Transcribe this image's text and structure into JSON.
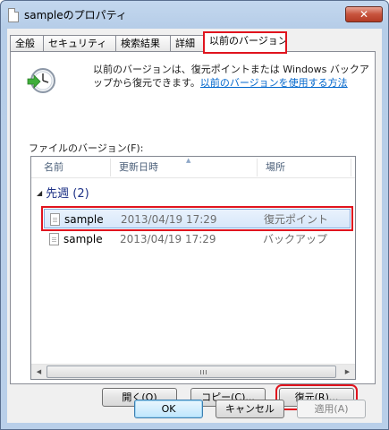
{
  "window": {
    "title": "sampleのプロパティ",
    "close_label": "✕"
  },
  "tabs": [
    {
      "label": "全般"
    },
    {
      "label": "セキュリティ"
    },
    {
      "label": "検索結果"
    },
    {
      "label": "詳細"
    },
    {
      "label": "以前のバージョン"
    }
  ],
  "panel": {
    "description": "以前のバージョンは、復元ポイントまたは Windows バックアップから復元できます。",
    "link_text": "以前のバージョンを使用する方法",
    "files_label": "ファイルのバージョン(F):"
  },
  "listview": {
    "columns": [
      "名前",
      "更新日時",
      "場所"
    ],
    "group": {
      "label": "先週 (2)"
    },
    "rows": [
      {
        "name": "sample",
        "date": "2013/04/19 17:29",
        "place": "復元ポイント"
      },
      {
        "name": "sample",
        "date": "2013/04/19 17:29",
        "place": "バックアップ"
      }
    ]
  },
  "actions": {
    "open": "開く(O)",
    "copy": "コピー(C)...",
    "restore": "復元(R)..."
  },
  "footer": {
    "ok": "OK",
    "cancel": "キャンセル",
    "apply": "適用(A)"
  }
}
